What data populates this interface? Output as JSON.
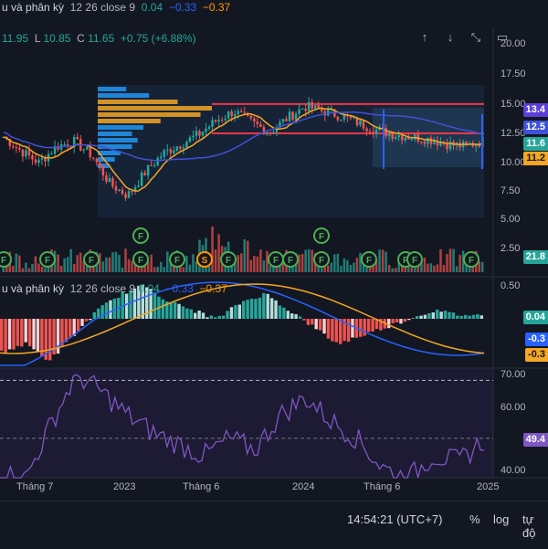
{
  "macd_header": {
    "name": "u và phân kỳ",
    "params": "12 26 close 9",
    "macd": "0.04",
    "signal": "−0.33",
    "hist": "−0.37"
  },
  "ohlc": {
    "o": "11.95",
    "l_label": "L",
    "l": "10.85",
    "c_label": "C",
    "c": "11.65",
    "change": "+0.75 (+6.88%)"
  },
  "macd_header2": {
    "name": "u và phân kỳ",
    "params": "12 26 close 9",
    "macd": "0.04",
    "signal": "−0.33",
    "hist": "−0.37"
  },
  "toolbar": {
    "up": "↑",
    "down": "↓",
    "collapse": "⤡",
    "window": "▭"
  },
  "price_axis": [
    "20.00",
    "17.50",
    "15.00",
    "12.50",
    "10.00",
    "7.50",
    "5.00",
    "2.50"
  ],
  "price_tags": {
    "t1": "13.4",
    "t2": "12.5",
    "t3": "11.6",
    "t4": "11.2",
    "vol": "21.8"
  },
  "macd_axis": [
    "0.50"
  ],
  "macd_tags": {
    "macd": "0.04",
    "signal": "-0.3",
    "hist": "-0.3"
  },
  "rsi_axis": [
    "70.00",
    "60.00",
    "40.00"
  ],
  "rsi_tag": "49.4",
  "x_axis": [
    "Tháng 7",
    "2023",
    "Tháng 6",
    "2024",
    "Tháng 6",
    "2025"
  ],
  "time": "14:54:21 (UTC+7)",
  "bottom_bar": {
    "percent": "%",
    "log": "log",
    "auto": "tự độ"
  },
  "marker_f": "F",
  "marker_s": "S",
  "colors": {
    "up": "#26a69a",
    "down": "#ef5350",
    "ma_fast": "#f5a623",
    "ma_slow": "#3f51d8",
    "rsi": "#7e57c2",
    "hline": "#f23645"
  },
  "chart_data": [
    {
      "type": "candlestick",
      "x": [
        "Tháng 7",
        "2023",
        "Tháng 6",
        "2024",
        "Tháng 6",
        "2025"
      ],
      "ylim": [
        2.5,
        20
      ],
      "series": [
        {
          "values": [
            12.0,
            10.8,
            9.8,
            11.2,
            11.6,
            10.4,
            8.0,
            7.0,
            9.0,
            10.6,
            11.4,
            12.2,
            13.4,
            14.2,
            13.2,
            12.4,
            13.6,
            14.6,
            14.2,
            13.8,
            13.2,
            12.6,
            12.2,
            12.0,
            11.8,
            11.4,
            11.2,
            11.65
          ]
        }
      ],
      "hlines": [
        14.8,
        12.3
      ]
    },
    {
      "type": "bar",
      "categories": [
        "Tháng 7",
        "2023",
        "Tháng 6",
        "2024",
        "Tháng 6",
        "2025"
      ],
      "series": [
        {
          "values": [
            -0.4,
            -0.3,
            -0.5,
            -0.2,
            0.1,
            0.3,
            0.4,
            0.2,
            0.1,
            0.0,
            0.2,
            0.3,
            0.1,
            -0.1,
            -0.3,
            -0.2,
            -0.1,
            0.0,
            0.1,
            0.05,
            0.04
          ]
        }
      ],
      "ylim": [
        -0.6,
        0.6
      ]
    },
    {
      "type": "line",
      "x": [
        "Tháng 7",
        "2023",
        "Tháng 6",
        "2024",
        "Tháng 6",
        "2025"
      ],
      "series": [
        {
          "values": [
            38,
            36,
            55,
            72,
            66,
            58,
            52,
            48,
            44,
            50,
            46,
            58,
            64,
            56,
            50,
            40,
            36,
            44,
            42,
            49.4
          ]
        }
      ],
      "ylim": [
        38,
        72
      ]
    }
  ]
}
